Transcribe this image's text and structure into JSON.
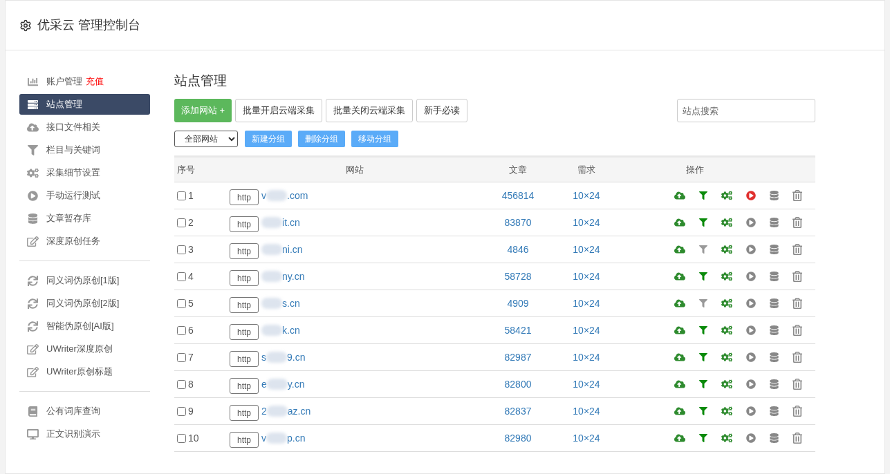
{
  "header": {
    "title": "优采云 管理控制台"
  },
  "sidebar": {
    "groups": [
      [
        {
          "label": "账户管理",
          "badge": "充值",
          "selected": false
        },
        {
          "label": "站点管理",
          "selected": true
        },
        {
          "label": "接口文件相关",
          "selected": false
        },
        {
          "label": "栏目与关键词",
          "selected": false
        },
        {
          "label": "采集细节设置",
          "selected": false
        },
        {
          "label": "手动运行测试",
          "selected": false
        },
        {
          "label": "文章暂存库",
          "selected": false
        },
        {
          "label": "深度原创任务",
          "selected": false
        }
      ],
      [
        {
          "label": "同义词伪原创[1版]",
          "selected": false
        },
        {
          "label": "同义词伪原创[2版]",
          "selected": false
        },
        {
          "label": "智能伪原创[AI版]",
          "selected": false
        },
        {
          "label": "UWriter深度原创",
          "selected": false
        },
        {
          "label": "UWriter原创标题",
          "selected": false
        }
      ],
      [
        {
          "label": "公有词库查询",
          "selected": false
        },
        {
          "label": "正文识别演示",
          "selected": false
        }
      ]
    ]
  },
  "page_title": "站点管理",
  "toolbar": {
    "primary": "添加网站 +",
    "buttons": [
      "批量开启云端采集",
      "批量关闭云端采集",
      "新手必读"
    ],
    "search": {
      "placeholder": "站点搜索"
    }
  },
  "group_bar": {
    "select": "全部网站",
    "buttons": [
      "新建分组",
      "删除分组",
      "移动分组"
    ]
  },
  "table": {
    "columns": [
      "序号",
      "网站",
      "文章",
      "需求",
      "操作"
    ],
    "rows": [
      {
        "checked": false,
        "index": "1",
        "protocol": "http",
        "site_start": "v",
        "site_end": ".com",
        "articles": "456814",
        "demand": "10×24",
        "filter_on": true,
        "running": true
      },
      {
        "checked": false,
        "index": "2",
        "protocol": "http",
        "site_start": "",
        "site_end": "it.cn",
        "articles": "83870",
        "demand": "10×24",
        "filter_on": true,
        "running": false
      },
      {
        "checked": false,
        "index": "3",
        "protocol": "http",
        "site_start": "",
        "site_end": "ni.cn",
        "articles": "4846",
        "demand": "10×24",
        "filter_on": false,
        "running": false
      },
      {
        "checked": false,
        "index": "4",
        "protocol": "http",
        "site_start": "",
        "site_end": "ny.cn",
        "articles": "58728",
        "demand": "10×24",
        "filter_on": true,
        "running": false
      },
      {
        "checked": false,
        "index": "5",
        "protocol": "http",
        "site_start": "",
        "site_end": "s.cn",
        "articles": "4909",
        "demand": "10×24",
        "filter_on": false,
        "running": false
      },
      {
        "checked": false,
        "index": "6",
        "protocol": "http",
        "site_start": "",
        "site_end": "k.cn",
        "articles": "58421",
        "demand": "10×24",
        "filter_on": true,
        "running": false
      },
      {
        "checked": false,
        "index": "7",
        "protocol": "http",
        "site_start": "s",
        "site_end": "9.cn",
        "articles": "82987",
        "demand": "10×24",
        "filter_on": true,
        "running": false
      },
      {
        "checked": false,
        "index": "8",
        "protocol": "http",
        "site_start": "e",
        "site_end": "y.cn",
        "articles": "82800",
        "demand": "10×24",
        "filter_on": true,
        "running": false
      },
      {
        "checked": false,
        "index": "9",
        "protocol": "http",
        "site_start": "2",
        "site_end": "az.cn",
        "articles": "82837",
        "demand": "10×24",
        "filter_on": true,
        "running": false
      },
      {
        "checked": false,
        "index": "10",
        "protocol": "http",
        "site_start": "v",
        "site_end": "p.cn",
        "articles": "82980",
        "demand": "10×24",
        "filter_on": true,
        "running": false
      }
    ]
  }
}
